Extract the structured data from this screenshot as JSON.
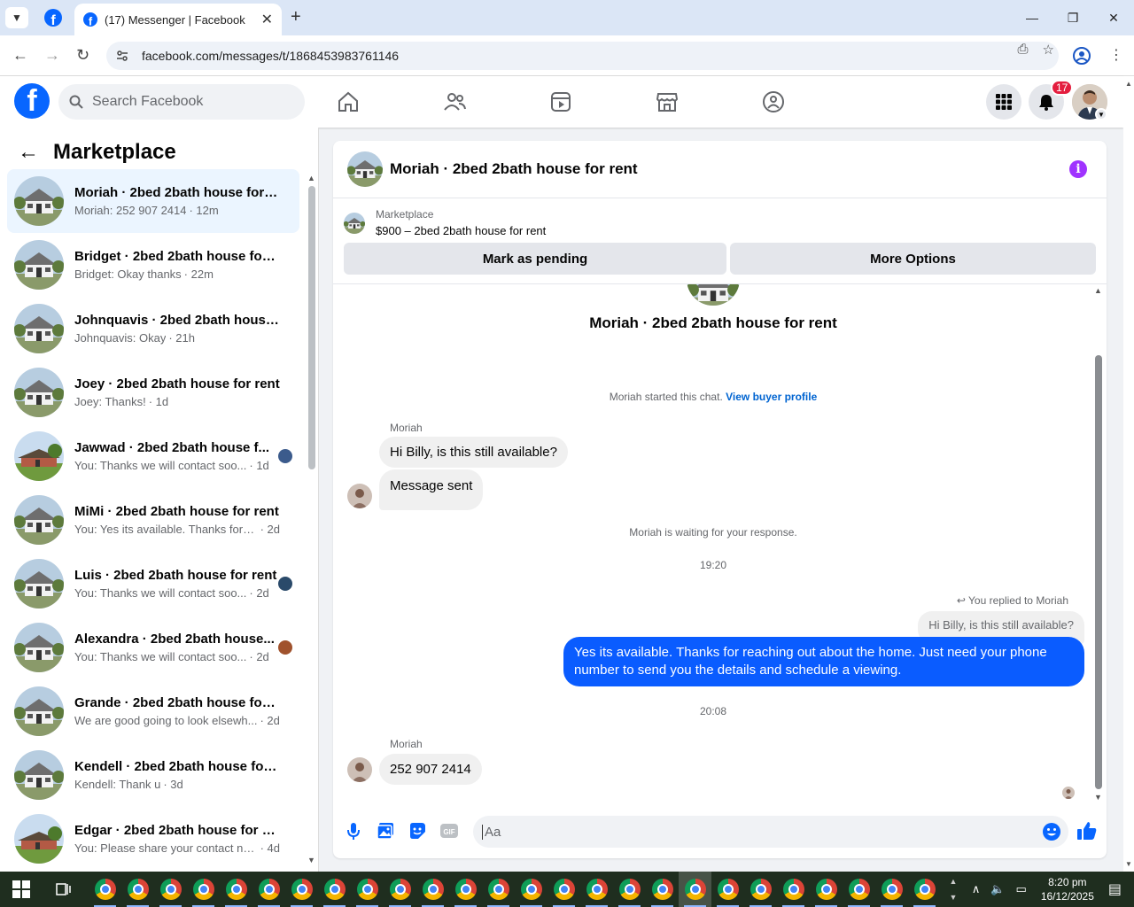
{
  "browser": {
    "tab_title": "(17) Messenger | Facebook",
    "url": "facebook.com/messages/t/1868453983761146",
    "new_tab_symbol": "+",
    "close_symbol": "✕"
  },
  "fb_header": {
    "search_placeholder": "Search Facebook",
    "notification_count": "17"
  },
  "sidebar": {
    "title": "Marketplace",
    "conversations": [
      {
        "name": "Moriah · 2bed 2bath house for r...",
        "snippet": "Moriah: 252 907 2414",
        "time": "· 12m",
        "active": true
      },
      {
        "name": "Bridget · 2bed 2bath house for r...",
        "snippet": "Bridget: Okay thanks",
        "time": "· 22m"
      },
      {
        "name": "Johnquavis · 2bed 2bath house f...",
        "snippet": "Johnquavis: Okay",
        "time": "· 21h"
      },
      {
        "name": "Joey · 2bed 2bath house for rent",
        "snippet": "Joey: Thanks!",
        "time": "· 1d"
      },
      {
        "name": "Jawwad · 2bed 2bath house f...",
        "snippet": "You: Thanks we will contact soo...",
        "time": "· 1d"
      },
      {
        "name": "MiMi · 2bed 2bath house for rent",
        "snippet": "You: Yes its available. Thanks for rea...",
        "time": "· 2d"
      },
      {
        "name": "Luis · 2bed 2bath house for rent",
        "snippet": "You: Thanks we will contact soo...",
        "time": "· 2d"
      },
      {
        "name": "Alexandra · 2bed 2bath house...",
        "snippet": "You: Thanks we will contact soo...",
        "time": "· 2d"
      },
      {
        "name": "Grande · 2bed 2bath house for r...",
        "snippet": "We are good going to look elsewh...",
        "time": "· 2d"
      },
      {
        "name": "Kendell · 2bed 2bath house for r...",
        "snippet": "Kendell: Thank u",
        "time": "· 3d"
      },
      {
        "name": "Edgar · 2bed 2bath house for rent",
        "snippet": "You: Please share your contact num...",
        "time": "· 4d"
      }
    ]
  },
  "chat": {
    "title": "Moriah · 2bed 2bath house for rent",
    "marketplace_label": "Marketplace",
    "listing": "$900 – 2bed 2bath house for rent",
    "mark_pending": "Mark as pending",
    "more_options": "More Options",
    "started_text": "Moriah started this chat.",
    "view_profile": "View buyer profile",
    "sender1": "Moriah",
    "msg1": "Hi Billy, is this still available?",
    "msg2": "Message sent",
    "waiting": "Moriah is waiting for your response.",
    "time1": "19:20",
    "replied_to": "You replied to Moriah",
    "quoted": "Hi Billy, is this still available?",
    "reply": "Yes its available. Thanks for reaching out about the home. Just need your phone number to send you the details and schedule a viewing.",
    "time2": "20:08",
    "sender2": "Moriah",
    "msg3": "252 907 2414",
    "composer_placeholder": "Aa"
  },
  "taskbar": {
    "time": "8:20 pm",
    "date": "16/12/2025"
  },
  "colors": {
    "fb_blue": "#0866ff",
    "out_bubble": "#0a5cff",
    "info_purple": "#a033ff",
    "badge_red": "#e41e3f"
  }
}
